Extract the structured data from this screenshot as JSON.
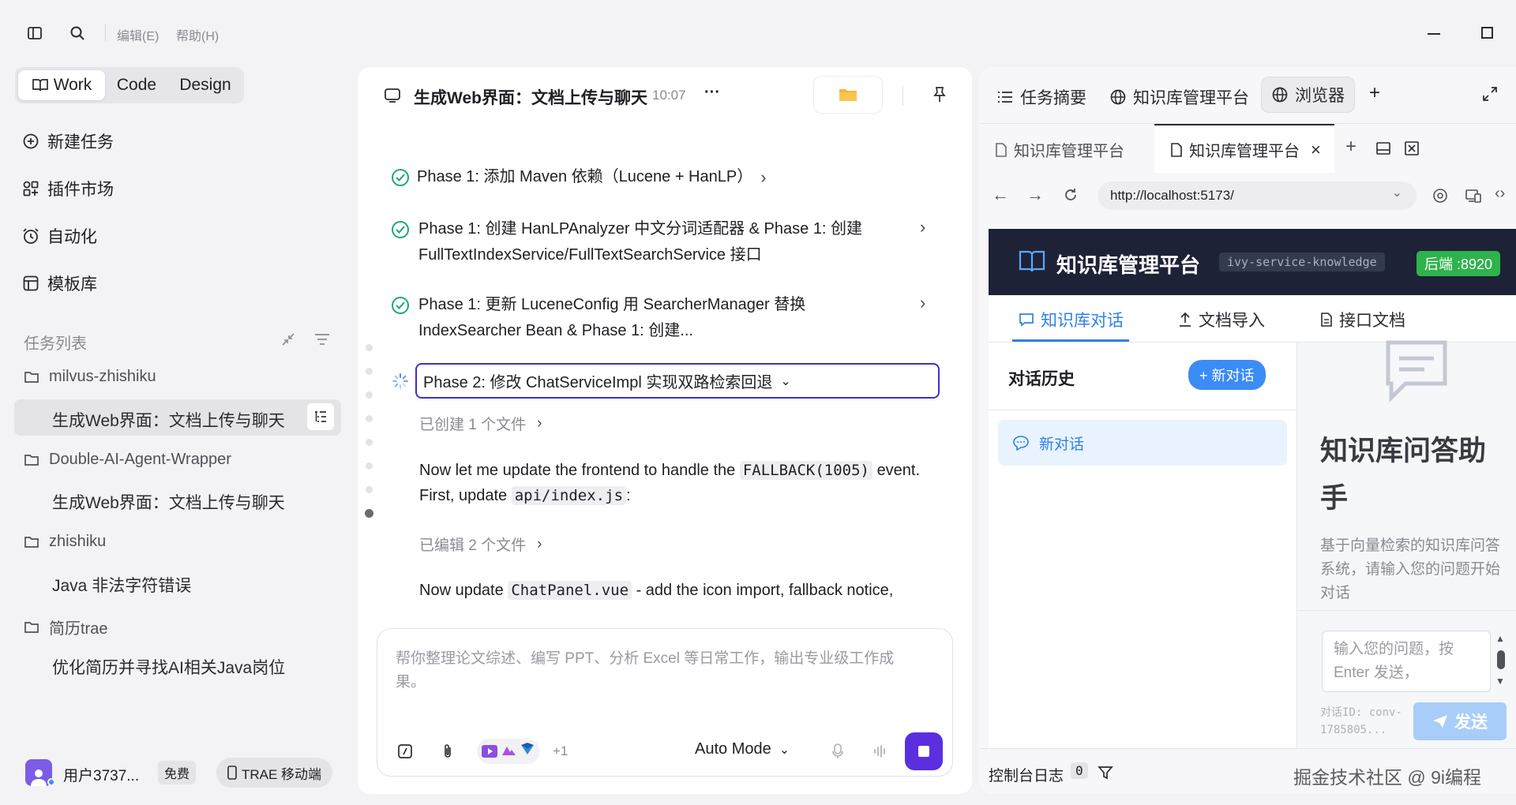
{
  "menu": {
    "edit": "编辑(E)",
    "help": "帮助(H)"
  },
  "modes": {
    "work": "Work",
    "code": "Code",
    "design": "Design"
  },
  "nav": {
    "new_task": "新建任务",
    "plugins": "插件市场",
    "automation": "自动化",
    "templates": "模板库"
  },
  "tasks": {
    "header": "任务列表",
    "groups": [
      {
        "folder": "milvus-zhishiku",
        "items": [
          "生成Web界面：文档上传与聊天"
        ]
      },
      {
        "folder": "Double-AI-Agent-Wrapper",
        "items": [
          "生成Web界面：文档上传与聊天"
        ]
      },
      {
        "folder": "zhishiku",
        "items": [
          "Java 非法字符错误"
        ]
      },
      {
        "folder": "简历trae",
        "items": [
          "优化简历并寻找AI相关Java岗位"
        ]
      }
    ]
  },
  "user": {
    "name": "用户3737...",
    "plan": "免费",
    "mobile": "TRAE 移动端"
  },
  "chat": {
    "title": "生成Web界面：文档上传与聊天",
    "time": "10:07",
    "more": "···",
    "phase1a": "Phase 1: 添加 Maven 依赖（Lucene + HanLP）",
    "phase1b_line1": "Phase 1: 创建 HanLPAnalyzer 中文分词适配器 & Phase 1: 创建",
    "phase1b_line2": "FullTextIndexService/FullTextSearchService 接口",
    "phase1c_line1": "Phase 1: 更新 LuceneConfig 用 SearcherManager 替换",
    "phase1c_line2": "IndexSearcher Bean & Phase 1: 创建...",
    "phase2": "Phase 2: 修改 ChatServiceImpl 实现双路检索回退",
    "created_files": "已创建 1 个文件",
    "msg1_pre": "Now let me update the frontend to handle the",
    "msg1_code1": "FALLBACK(1005)",
    "msg1_mid": "event. First, update",
    "msg1_code2": "api/index.js",
    "msg1_end": ":",
    "edited_files": "已编辑 2 个文件",
    "msg2_pre": "Now update",
    "msg2_code": "ChatPanel.vue",
    "msg2_end": "- add the icon import, fallback notice,",
    "input_placeholder": "帮你整理论文综述、编写 PPT、分析 Excel 等日常工作，输出专业级工作成果。",
    "plus_count": "+1",
    "auto_mode": "Auto Mode"
  },
  "right_tabs": {
    "summary": "任务摘要",
    "kb": "知识库管理平台",
    "browser": "浏览器",
    "add": "+"
  },
  "browser": {
    "tab1": "知识库管理平台",
    "tab2": "知识库管理平台",
    "close": "×",
    "add": "+",
    "url": "http://localhost:5173/"
  },
  "web": {
    "title": "知识库管理平台",
    "service": "ivy-service-knowledge",
    "backend": "后端 :8920",
    "nav_chat": "知识库对话",
    "nav_import": "文档导入",
    "nav_api": "接口文档",
    "history": "对话历史",
    "new_chat_btn": "+ 新对话",
    "conv_item": "新对话",
    "assistant_title": "知识库问答助手",
    "assistant_desc": "基于向量检索的知识库问答系统，请输入您的问题开始对话",
    "input_placeholder": "输入您的问题，按 Enter 发送，",
    "conv_id": "对话ID: conv-1785805...",
    "send": "发送"
  },
  "console": {
    "label": "控制台日志",
    "count": "0"
  },
  "watermark": "掘金技术社区 @ 9i编程"
}
